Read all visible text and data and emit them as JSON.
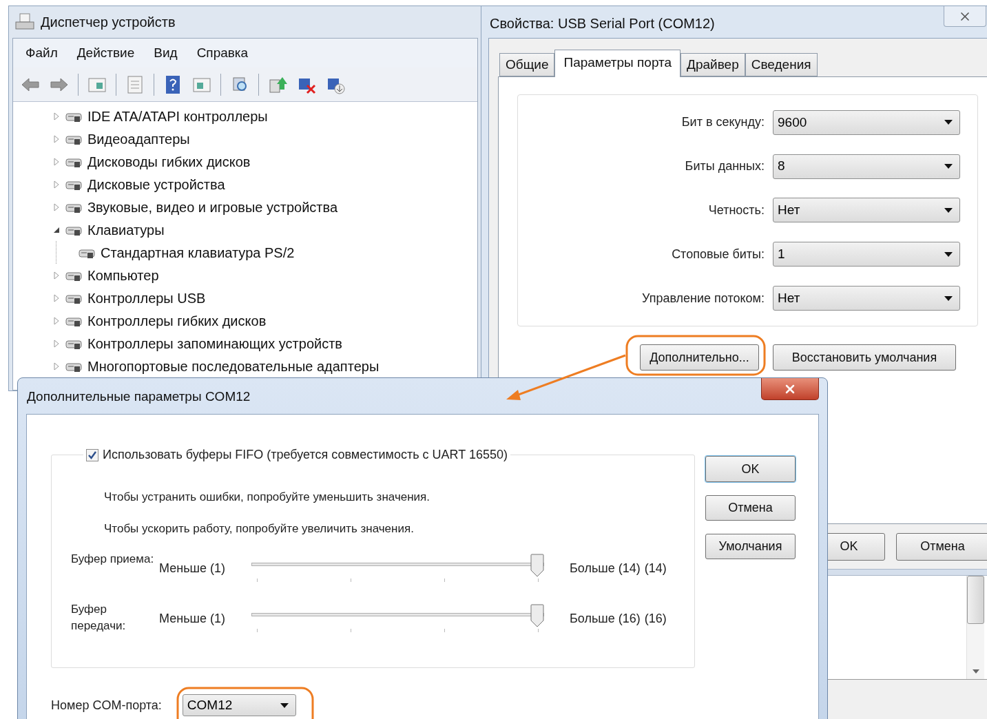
{
  "device_manager": {
    "title": "Диспетчер устройств",
    "menu": [
      "Файл",
      "Действие",
      "Вид",
      "Справка"
    ],
    "tree": [
      {
        "label": "IDE ATA/ATAPI контроллеры",
        "expanded": false
      },
      {
        "label": "Видеоадаптеры",
        "expanded": false
      },
      {
        "label": "Дисководы гибких дисков",
        "expanded": false
      },
      {
        "label": "Дисковые устройства",
        "expanded": false
      },
      {
        "label": "Звуковые, видео и игровые устройства",
        "expanded": false
      },
      {
        "label": "Клавиатуры",
        "expanded": true,
        "children": [
          {
            "label": "Стандартная клавиатура PS/2"
          }
        ]
      },
      {
        "label": "Компьютер",
        "expanded": false
      },
      {
        "label": "Контроллеры USB",
        "expanded": false
      },
      {
        "label": "Контроллеры гибких дисков",
        "expanded": false
      },
      {
        "label": "Контроллеры запоминающих устройств",
        "expanded": false
      },
      {
        "label": "Многопортовые последовательные адаптеры",
        "expanded": false
      }
    ]
  },
  "properties": {
    "title": "Свойства: USB Serial Port (COM12)",
    "tabs": [
      {
        "label": "Общие",
        "selected": false
      },
      {
        "label": "Параметры порта",
        "selected": true
      },
      {
        "label": "Драйвер",
        "selected": false
      },
      {
        "label": "Сведения",
        "selected": false
      }
    ],
    "fields": [
      {
        "label": "Бит в секунду:",
        "value": "9600"
      },
      {
        "label": "Биты данных:",
        "value": "8"
      },
      {
        "label": "Четность:",
        "value": "Нет"
      },
      {
        "label": "Стоповые биты:",
        "value": "1"
      },
      {
        "label": "Управление потоком:",
        "value": "Нет"
      }
    ],
    "buttons": [
      "Дополнительно...",
      "Восстановить умолчания"
    ],
    "footer_buttons": [
      "OK",
      "Отмена"
    ]
  },
  "dialog": {
    "title": "Дополнительные параметры COM12",
    "fifo": {
      "label": "Использовать буферы FIFO (требуется совместимость с UART 16550)",
      "checked": true
    },
    "hints": [
      "Чтобы устранить ошибки, попробуйте уменьшить значения.",
      "Чтобы ускорить работу, попробуйте увеличить значения."
    ],
    "sliders": [
      {
        "label": "Буфер приема:",
        "min_label": "Меньше (1)",
        "max_label": "Больше (14)",
        "reading": "(14)",
        "level": 1
      },
      {
        "label": "Буфер передачи:",
        "min_label": "Меньше (1)",
        "max_label": "Больше (16)",
        "reading": "(16)",
        "level": 1
      }
    ],
    "buttons": [
      "OK",
      "Отмена",
      "Умолчания"
    ],
    "com_port": {
      "label": "Номер COM-порта:",
      "value": "COM12"
    }
  }
}
